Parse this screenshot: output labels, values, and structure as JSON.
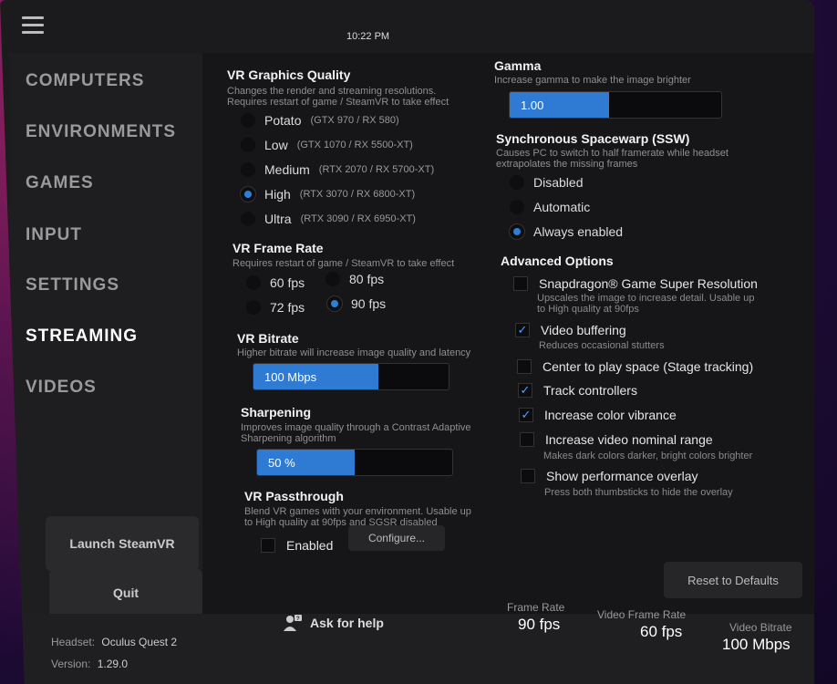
{
  "clock": "10:22 PM",
  "sidebar": {
    "items": [
      {
        "label": "COMPUTERS"
      },
      {
        "label": "ENVIRONMENTS"
      },
      {
        "label": "GAMES"
      },
      {
        "label": "INPUT"
      },
      {
        "label": "SETTINGS"
      },
      {
        "label": "STREAMING"
      },
      {
        "label": "VIDEOS"
      }
    ],
    "active": "STREAMING",
    "launch_label": "Launch SteamVR",
    "quit_label": "Quit"
  },
  "graphics": {
    "title": "VR Graphics Quality",
    "subtitle_1": "Changes the render and streaming resolutions.",
    "subtitle_2": "Requires restart of game / SteamVR to take effect",
    "options": [
      {
        "label": "Potato",
        "note": "(GTX 970 / RX 580)"
      },
      {
        "label": "Low",
        "note": "(GTX 1070 / RX 5500-XT)"
      },
      {
        "label": "Medium",
        "note": "(RTX 2070 / RX 5700-XT)"
      },
      {
        "label": "High",
        "note": "(RTX 3070 / RX 6800-XT)"
      },
      {
        "label": "Ultra",
        "note": "(RTX 3090 / RX 6950-XT)"
      }
    ],
    "selected": "High"
  },
  "framerate": {
    "title": "VR Frame Rate",
    "subtitle": "Requires restart of game / SteamVR to take effect",
    "options": [
      "60 fps",
      "80 fps",
      "72 fps",
      "90 fps"
    ],
    "selected": "90 fps"
  },
  "bitrate": {
    "title": "VR Bitrate",
    "subtitle": "Higher bitrate will increase image quality and latency",
    "value": "100 Mbps",
    "fill_fraction": 0.64
  },
  "sharpening": {
    "title": "Sharpening",
    "subtitle_1": "Improves image quality through a Contrast Adaptive",
    "subtitle_2": "Sharpening algorithm",
    "value": "50 %",
    "fill_fraction": 0.5
  },
  "passthrough": {
    "title": "VR Passthrough",
    "subtitle_1": "Blend VR games with your environment. Usable up",
    "subtitle_2": "to High quality at 90fps and SGSR disabled",
    "enabled_label": "Enabled",
    "enabled": false,
    "configure_label": "Configure..."
  },
  "gamma": {
    "title": "Gamma",
    "subtitle": "Increase gamma to make the image brighter",
    "value": "1.00",
    "fill_fraction": 0.47
  },
  "ssw": {
    "title": "Synchronous Spacewarp (SSW)",
    "subtitle_1": "Causes PC to switch to half framerate while headset",
    "subtitle_2": "extrapolates the missing frames",
    "options": [
      "Disabled",
      "Automatic",
      "Always enabled"
    ],
    "selected": "Always enabled"
  },
  "advanced": {
    "title": "Advanced Options",
    "options": [
      {
        "label": "Snapdragon® Game Super Resolution",
        "checked": false,
        "sub_1": "Upscales the image to increase detail. Usable up",
        "sub_2": "to High quality at 90fps"
      },
      {
        "label": "Video buffering",
        "checked": true,
        "sub_1": "Reduces occasional stutters",
        "sub_2": ""
      },
      {
        "label": "Center to play space (Stage tracking)",
        "checked": false,
        "sub_1": "",
        "sub_2": ""
      },
      {
        "label": "Track controllers",
        "checked": true,
        "sub_1": "",
        "sub_2": ""
      },
      {
        "label": "Increase color vibrance",
        "checked": true,
        "sub_1": "",
        "sub_2": ""
      },
      {
        "label": "Increase video nominal range",
        "checked": false,
        "sub_1": "Makes dark colors darker, bright colors brighter",
        "sub_2": ""
      },
      {
        "label": "Show performance overlay",
        "checked": false,
        "sub_1": "Press both thumbsticks to hide the overlay",
        "sub_2": ""
      }
    ],
    "reset_label": "Reset to Defaults"
  },
  "footer": {
    "headset_label": "Headset:",
    "headset_value": "Oculus Quest 2",
    "version_label": "Version:",
    "version_value": "1.29.0",
    "help_label": "Ask for help",
    "stats": [
      {
        "label": "Frame Rate",
        "value": "90 fps"
      },
      {
        "label": "Video Frame Rate",
        "value": "60 fps"
      },
      {
        "label": "Video Bitrate",
        "value": "100 Mbps"
      }
    ]
  },
  "colors": {
    "accent": "#2f7bd4",
    "panel": "#1b1b1d"
  },
  "icons": [
    "hamburger-menu-icon",
    "help-person-icon",
    "checkmark-icon"
  ]
}
